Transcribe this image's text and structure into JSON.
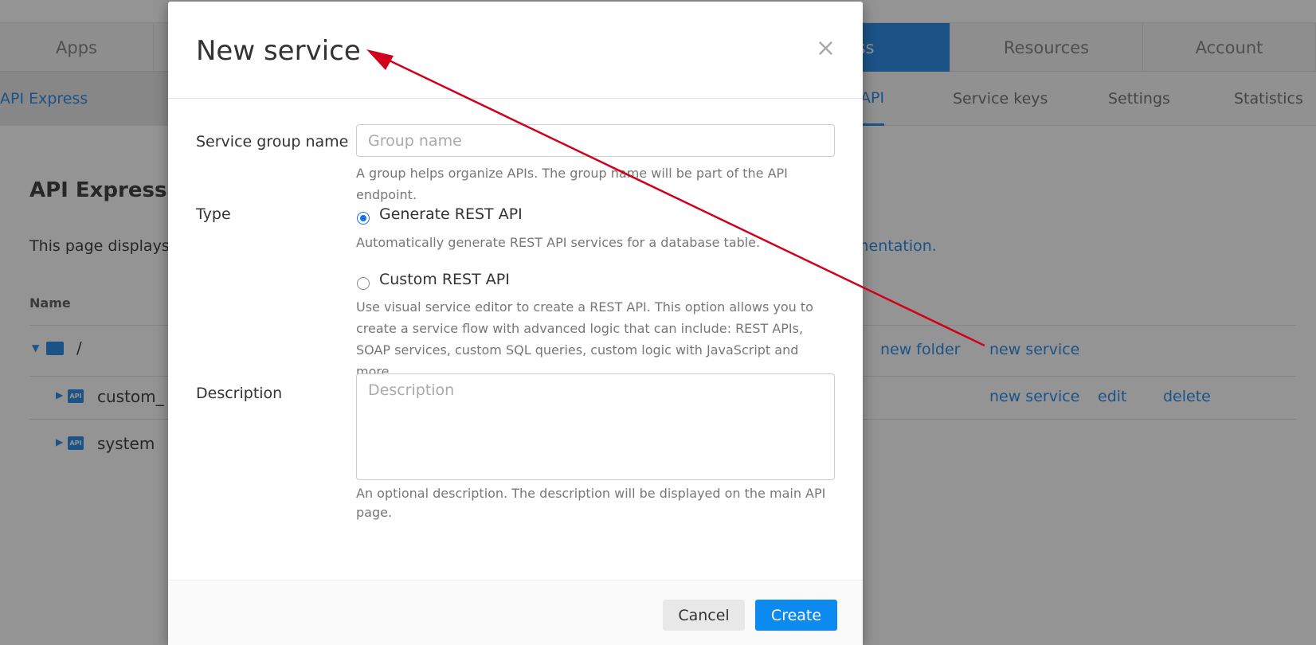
{
  "background": {
    "nav_tabs": [
      {
        "label": "Apps"
      },
      {
        "label": "ress"
      },
      {
        "label": "Resources"
      },
      {
        "label": "Account"
      }
    ],
    "breadcrumb": "API Express",
    "sub_tabs": [
      {
        "label": "API"
      },
      {
        "label": "Service keys"
      },
      {
        "label": "Settings"
      },
      {
        "label": "Statistics"
      }
    ],
    "page_title": "API Express",
    "page_desc": "This page displays",
    "page_desc_link": "umentation.",
    "column_name": "Name",
    "tree": {
      "root_label": "/",
      "root_actions": {
        "new_folder": "new folder",
        "new_service": "new service"
      },
      "items": [
        {
          "label": "custom_",
          "actions": {
            "new_service": "new service",
            "edit": "edit",
            "delete": "delete"
          }
        },
        {
          "label": "system"
        }
      ],
      "api_icon_text": "API"
    }
  },
  "modal": {
    "title": "New service",
    "close_glyph": "×",
    "service_group": {
      "label": "Service group name",
      "placeholder": "Group name",
      "value": "",
      "help": "A group helps organize APIs. The group name will be part of the API endpoint."
    },
    "type": {
      "label": "Type",
      "options": [
        {
          "label": "Generate REST API",
          "checked": true,
          "help": "Automatically generate REST API services for a database table."
        },
        {
          "label": "Custom REST API",
          "checked": false,
          "help": "Use visual service editor to create a REST API. This option allows you to create a service flow with advanced logic that can include: REST APIs, SOAP services, custom SQL queries, custom logic with JavaScript and more."
        }
      ]
    },
    "description": {
      "label": "Description",
      "placeholder": "Description",
      "value": "",
      "help": "An optional description. The description will be displayed on the main API page."
    },
    "buttons": {
      "cancel": "Cancel",
      "create": "Create"
    }
  },
  "colors": {
    "accent": "#2f8fe8",
    "primary_button": "#0d8af0",
    "annotation_arrow": "#d0021b"
  }
}
